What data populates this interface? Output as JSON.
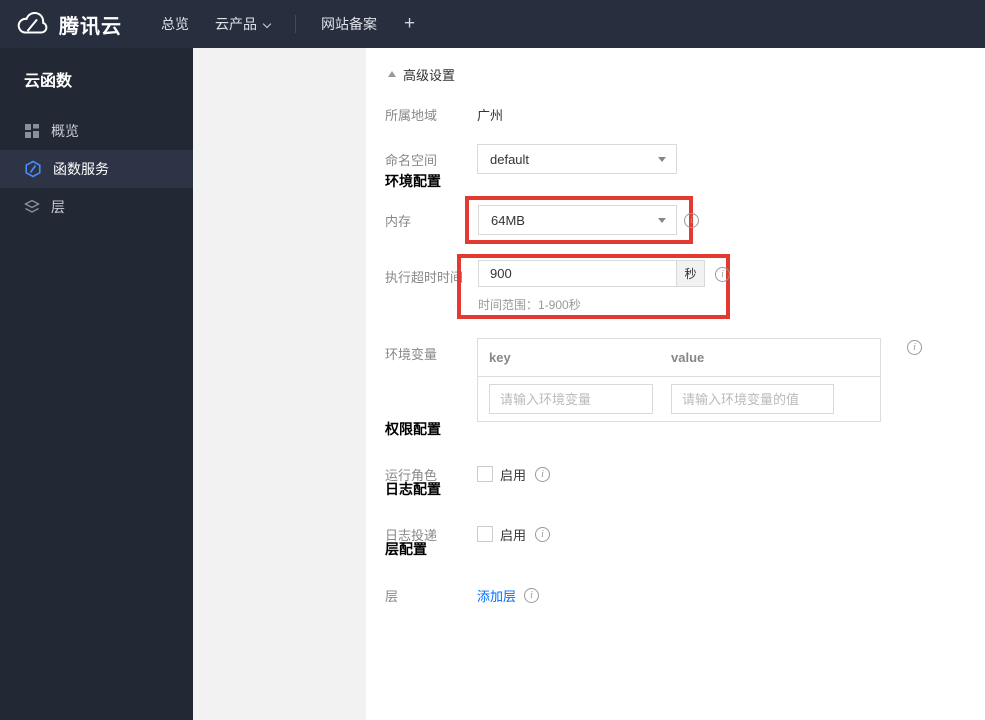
{
  "topbar": {
    "logo_text": "腾讯云",
    "nav_overview": "总览",
    "nav_products": "云产品",
    "nav_icp": "网站备案",
    "add_tab": "+"
  },
  "sidebar": {
    "title": "云函数",
    "items": [
      {
        "label": "概览"
      },
      {
        "label": "函数服务"
      },
      {
        "label": "层"
      }
    ]
  },
  "content": {
    "advanced_toggle": "高级设置",
    "section_headers": {
      "env": "环境配置",
      "perm": "权限配置",
      "log": "日志配置",
      "layer": "层配置"
    },
    "rows": {
      "region": {
        "label": "所属地域",
        "value": "广州"
      },
      "namespace": {
        "label": "命名空间",
        "value": "default"
      },
      "memory": {
        "label": "内存",
        "value": "64MB"
      },
      "timeout": {
        "label": "执行超时时间",
        "value": "900",
        "unit": "秒",
        "hint": "时间范围：1-900秒"
      },
      "env_vars": {
        "label": "环境变量",
        "key_header": "key",
        "value_header": "value",
        "key_placeholder": "请输入环境变量",
        "value_placeholder": "请输入环境变量的值"
      },
      "run_role": {
        "label": "运行角色",
        "enable": "启用"
      },
      "log_delivery": {
        "label": "日志投递",
        "enable": "启用"
      },
      "layer": {
        "label": "层",
        "add_link": "添加层"
      }
    }
  },
  "colors": {
    "annotation_red": "#e23a30",
    "link_blue": "#006eff",
    "topbar_bg": "#272e3d",
    "sidebar_bg": "#222834",
    "sidebar_active_bg": "#2c3445",
    "function_icon_blue": "#4a8cff"
  }
}
